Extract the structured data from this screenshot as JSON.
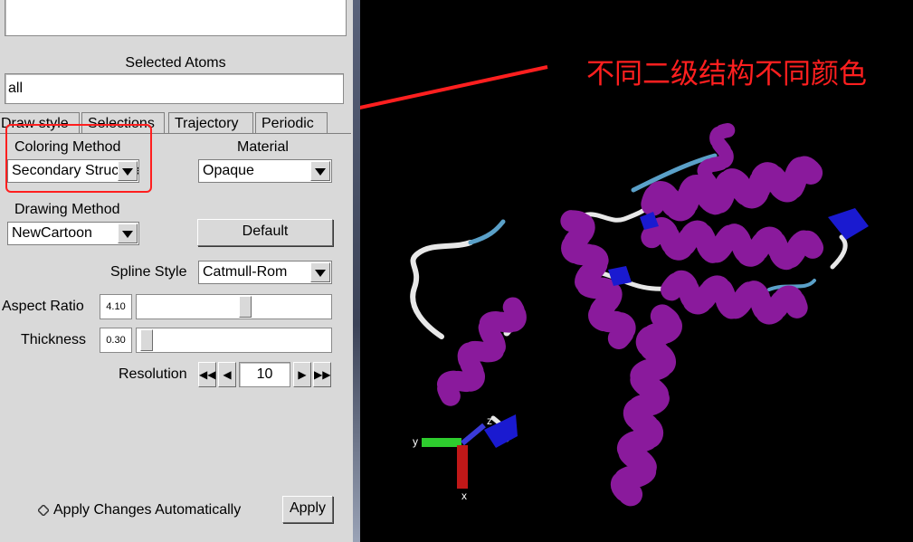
{
  "selected_atoms": {
    "label": "Selected Atoms",
    "value": "all"
  },
  "tabs": [
    {
      "label": "Draw style"
    },
    {
      "label": "Selections"
    },
    {
      "label": "Trajectory"
    },
    {
      "label": "Periodic"
    }
  ],
  "coloring": {
    "label": "Coloring Method",
    "value": "Secondary Structure"
  },
  "material": {
    "label": "Material",
    "value": "Opaque"
  },
  "drawing": {
    "label": "Drawing Method",
    "value": "NewCartoon",
    "default_label": "Default"
  },
  "spline": {
    "label": "Spline Style",
    "value": "Catmull-Rom"
  },
  "aspect": {
    "label": "Aspect Ratio",
    "value": "4.10",
    "level": 0.56
  },
  "thickness": {
    "label": "Thickness",
    "value": "0.30",
    "level": 0.02
  },
  "resolution": {
    "label": "Resolution",
    "value": "10"
  },
  "footer": {
    "auto_label": "Apply Changes Automatically",
    "apply_label": "Apply"
  },
  "annotation": {
    "text": "不同二级结构不同颜色",
    "color": "#ff1f1f"
  },
  "axes": {
    "y": "y",
    "x": "x",
    "z": "z"
  },
  "colors": {
    "helix": "#8a1a9c",
    "turn": "#5aa0c8",
    "coil": "#e8e8e8",
    "strand": "#1a1ad0"
  }
}
